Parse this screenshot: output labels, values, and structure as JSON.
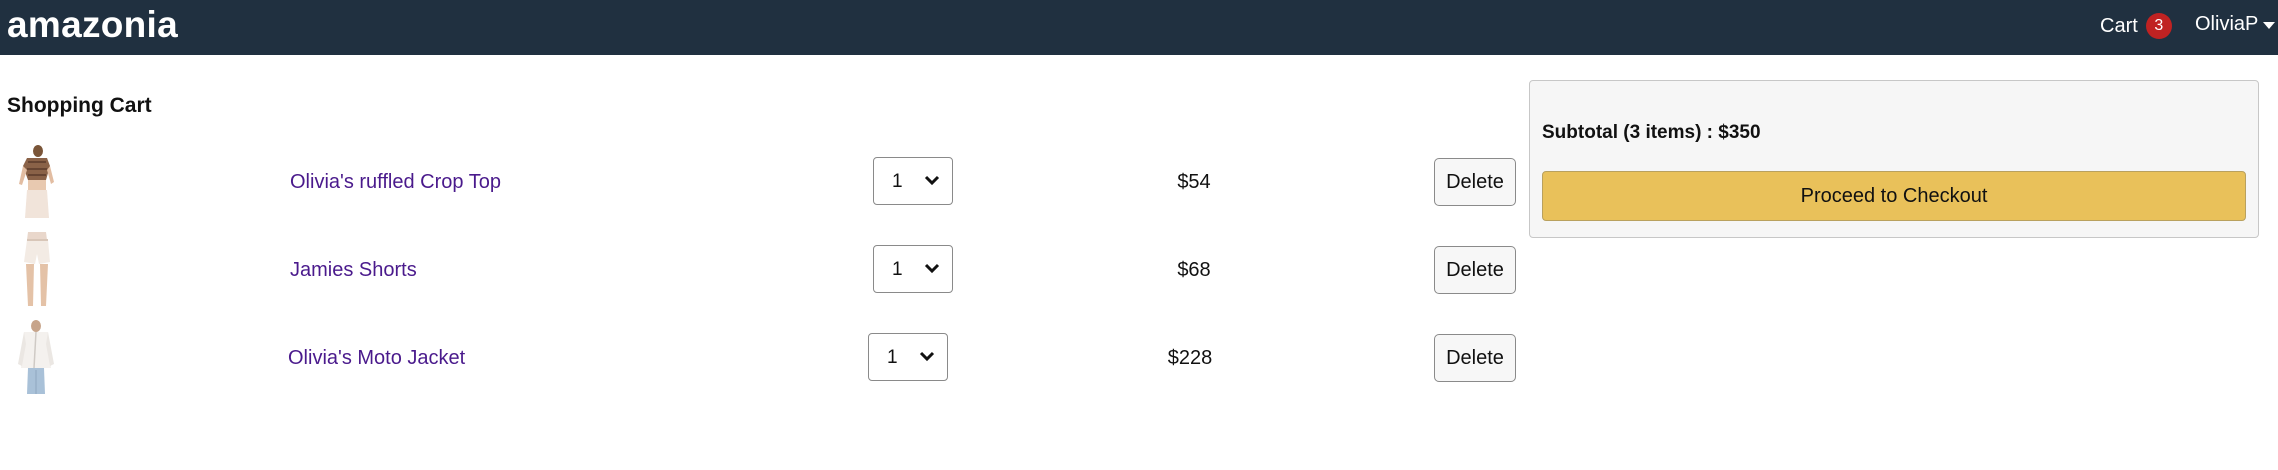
{
  "header": {
    "brand": "amazonia",
    "cart_label": "Cart",
    "cart_count": "3",
    "user_name": "OliviaP"
  },
  "cart": {
    "title": "Shopping Cart",
    "items": [
      {
        "name": "Olivia's ruffled Crop Top",
        "qty": "1",
        "price": "$54",
        "delete_label": "Delete",
        "image": "crop-top-photo"
      },
      {
        "name": "Jamies Shorts",
        "qty": "1",
        "price": "$68",
        "delete_label": "Delete",
        "image": "shorts-photo"
      },
      {
        "name": "Olivia's Moto Jacket",
        "qty": "1",
        "price": "$228",
        "delete_label": "Delete",
        "image": "moto-jacket-photo"
      }
    ]
  },
  "summary": {
    "subtotal": "Subtotal (3 items) : $350",
    "checkout_label": "Proceed to Checkout"
  },
  "colors": {
    "header_bg": "#203040",
    "badge": "#c02222",
    "link": "#4a1a8c",
    "checkout_button": "#e9c15a"
  }
}
